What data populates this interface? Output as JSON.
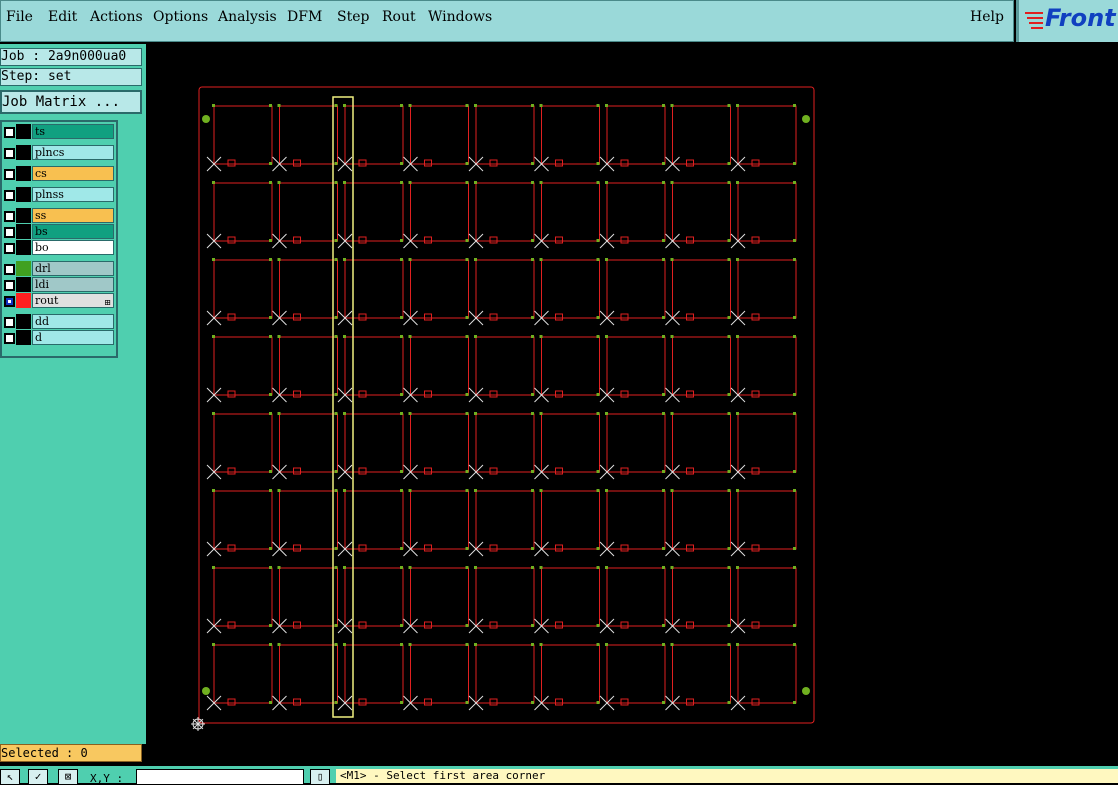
{
  "menu": {
    "items": [
      {
        "label": "File"
      },
      {
        "label": "Edit"
      },
      {
        "label": "Actions"
      },
      {
        "label": "Options"
      },
      {
        "label": "Analysis"
      },
      {
        "label": "DFM"
      },
      {
        "label": "Step"
      },
      {
        "label": "Rout"
      },
      {
        "label": "Windows"
      }
    ],
    "help": "Help"
  },
  "logo": {
    "text": "Front"
  },
  "job": {
    "label": "Job : 2a9n000ua0"
  },
  "step": {
    "label": "Step: set"
  },
  "job_matrix": {
    "label": "Job Matrix ..."
  },
  "layers": [
    {
      "name": "ts",
      "color": "#10a080",
      "swatch": "#000000"
    },
    {
      "name": "plncs",
      "color": "#a0e8e8",
      "swatch": "#000000"
    },
    {
      "name": "cs",
      "color": "#f8c050",
      "swatch": "#000000"
    },
    {
      "name": "plnss",
      "color": "#a0e8e8",
      "swatch": "#000000"
    },
    {
      "name": "ss",
      "color": "#f8c050",
      "swatch": "#000000"
    },
    {
      "name": "bs",
      "color": "#10a080",
      "swatch": "#000000"
    },
    {
      "name": "bo",
      "color": "#ffffff",
      "swatch": "#000000"
    },
    {
      "name": "drl",
      "color": "#a0c8c8",
      "swatch": "#40a020"
    },
    {
      "name": "ldi",
      "color": "#a0c8c8",
      "swatch": "#000000"
    },
    {
      "name": "rout",
      "color": "#e0e0e0",
      "swatch": "#ff2020",
      "active": true
    },
    {
      "name": "dd",
      "color": "#a0e8e8",
      "swatch": "#000000"
    },
    {
      "name": "d",
      "color": "#a0e8e8",
      "swatch": "#000000"
    }
  ],
  "selected": {
    "label": "Selected : 0"
  },
  "coords": {
    "label": "X,Y :",
    "value": ""
  },
  "prompt": {
    "text": "<M1> - Select first area corner"
  },
  "colors": {
    "rout_outline": "#e02020",
    "pads": "#70b020",
    "selection_box": "#f0f080",
    "cross_marks": "#e0e0e0"
  },
  "board": {
    "columns": 9,
    "rows": 8
  }
}
